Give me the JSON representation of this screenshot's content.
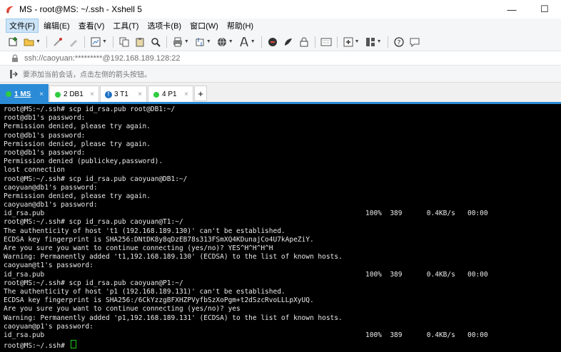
{
  "window": {
    "title": "MS - root@MS: ~/.ssh - Xshell 5",
    "minimize": "—",
    "maximize": "☐"
  },
  "menu": [
    "文件(F)",
    "编辑(E)",
    "查看(V)",
    "工具(T)",
    "选项卡(B)",
    "窗口(W)",
    "帮助(H)"
  ],
  "address": {
    "text": "ssh://caoyuan:*********@192.168.189.128:22"
  },
  "hint": {
    "text": "要添加当前会话，点击左侧的箭头按钮。"
  },
  "tabs": [
    {
      "label": "1 MS",
      "color": "#2ecc40",
      "active": true
    },
    {
      "label": "2 DB1",
      "color": "#2ecc40",
      "active": false
    },
    {
      "label": "3 T1",
      "color": "#1a6fc5",
      "active": false
    },
    {
      "label": "4 P1",
      "color": "#2ecc40",
      "active": false
    }
  ],
  "tab_close": "×",
  "tab_add": "+",
  "terminal": {
    "lines": [
      {
        "text": "root@MS:~/.ssh# scp id_rsa.pub root@DB1:~/"
      },
      {
        "text": "root@db1's password:"
      },
      {
        "text": "Permission denied, please try again."
      },
      {
        "text": "root@db1's password:"
      },
      {
        "text": "Permission denied, please try again."
      },
      {
        "text": "root@db1's password:"
      },
      {
        "text": "Permission denied (publickey,password)."
      },
      {
        "text": "lost connection"
      },
      {
        "text": "root@MS:~/.ssh# scp id_rsa.pub caoyuan@DB1:~/"
      },
      {
        "text": "caoyuan@db1's password:"
      },
      {
        "text": "Permission denied, please try again."
      },
      {
        "text": "caoyuan@db1's password:"
      },
      {
        "text": "id_rsa.pub",
        "stat": "100%  389      0.4KB/s   00:00"
      },
      {
        "text": "root@MS:~/.ssh# scp id_rsa.pub caoyuan@T1:~/"
      },
      {
        "text": "The authenticity of host 't1 (192.168.189.130)' can't be established."
      },
      {
        "text": "ECDSA key fingerprint is SHA256:DNtDK8y8qDzEB78s313FSmXQ4KDunajCo4U7kApeZiY."
      },
      {
        "text": "Are you sure you want to continue connecting (yes/no)? YES^H^H^H^H"
      },
      {
        "text": "Warning: Permanently added 't1,192.168.189.130' (ECDSA) to the list of known hosts."
      },
      {
        "text": "caoyuan@t1's password:"
      },
      {
        "text": "id_rsa.pub",
        "stat": "100%  389      0.4KB/s   00:00"
      },
      {
        "text": "root@MS:~/.ssh# scp id_rsa.pub caoyuan@P1:~/"
      },
      {
        "text": "The authenticity of host 'p1 (192.168.189.131)' can't be established."
      },
      {
        "text": "ECDSA key fingerprint is SHA256:/6CkYzzgBFXHZPVyfbSzXoPgm+t2dSzcRvoLLLpXyUQ."
      },
      {
        "text": "Are you sure you want to continue connecting (yes/no)? yes"
      },
      {
        "text": "Warning: Permanently added 'p1,192.168.189.131' (ECDSA) to the list of known hosts."
      },
      {
        "text": "caoyuan@p1's password:"
      },
      {
        "text": "id_rsa.pub",
        "stat": "100%  389      0.4KB/s   00:00"
      }
    ],
    "prompt": "root@MS:~/.ssh# ",
    "cursor_color": "#22c922"
  },
  "colors": {
    "accent": "#2b8bd6",
    "terminal_bg": "#000000",
    "terminal_fg": "#eaeaea"
  },
  "toolbar_icons": [
    "new-session-icon",
    "open-folder-icon",
    "disconnect-icon",
    "edit-icon",
    "properties-icon",
    "copy-icon",
    "paste-icon",
    "find-icon",
    "print-icon",
    "transfer-icon",
    "globe-icon",
    "font-icon",
    "xftp-icon",
    "xmanager-icon",
    "lock-icon",
    "fullscreen-icon",
    "transparent-icon",
    "keyboard-icon",
    "new-tab-icon",
    "layout-icon",
    "help-icon",
    "chat-icon"
  ]
}
